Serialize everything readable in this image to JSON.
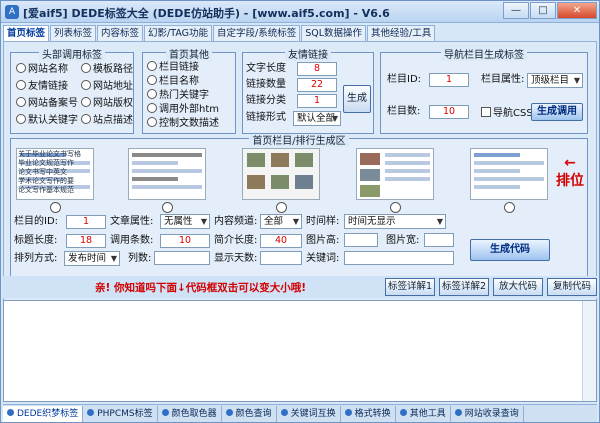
{
  "window": {
    "title": "[爱aif5] DEDE标签大全 (DEDE仿站助手) - [www.aif5.com] - V6.6",
    "icon_letter": "A",
    "minimize": "—",
    "maximize": "□",
    "close": "✕"
  },
  "tabs": [
    {
      "label": "首页标签"
    },
    {
      "label": "列表标签"
    },
    {
      "label": "内容标签"
    },
    {
      "label": "幻影/TAG功能"
    },
    {
      "label": "自定字段/系统标签"
    },
    {
      "label": "SQL数据操作"
    },
    {
      "label": "其他经验/工具"
    }
  ],
  "header_common": {
    "title": "头部调用标签",
    "items": [
      "网站名称",
      "模板路径",
      "友情链接",
      "网站地址",
      "网站备案号",
      "网站版权",
      "默认关键字",
      "站点描述"
    ]
  },
  "homepage_other": {
    "title": "首页其他",
    "items": [
      "栏目链接",
      "栏目名称",
      "热门关键字",
      "调用外部htm",
      "控制文数描述"
    ]
  },
  "friend_links": {
    "title": "友情链接",
    "text_length_label": "文字长度",
    "text_length": "8",
    "link_count_label": "链接数量",
    "link_count": "22",
    "link_category_label": "链接分类",
    "link_category": "1",
    "link_style_label": "链接形式",
    "link_style": "默认全部",
    "generate_button": "生成"
  },
  "nav_columns": {
    "title": "导航栏目生成标签",
    "column_id_label": "栏目ID:",
    "column_id": "1",
    "column_attr_label": "栏目属性:",
    "column_attr": "顶级栏目",
    "column_count_label": "栏目数:",
    "column_count": "10",
    "nav_css_label": "导航CSS",
    "call_button": "生成调用"
  },
  "column_list": {
    "title": "首页栏目/排行生成区",
    "sort_label": "排位",
    "arrow": "←",
    "column_id_label": "栏目的ID:",
    "column_id": "1",
    "article_attr_label": "文章属性:",
    "article_attr": "无属性",
    "content_channel_label": "内容频道:",
    "content_channel": "全部",
    "time_style_label": "时间样:",
    "time_style": "时间无显示",
    "title_length_label": "标题长度:",
    "title_length": "18",
    "call_count_label": "调用条数:",
    "call_count": "10",
    "intro_length_label": "简介长度:",
    "intro_length": "40",
    "img_height_label": "图片高:",
    "img_height": "",
    "img_width_label": "图片宽:",
    "img_width": "",
    "sort_method_label": "排列方式:",
    "sort_method": "发布时间",
    "columns_label": "列数:",
    "columns": "",
    "show_days_label": "显示天数:",
    "show_days": "",
    "keywords_label": "关键词:",
    "keywords": "",
    "generate_code_button": "生成代码",
    "thumb_text": [
      "关于毕业论文书写格",
      "毕业论文规范写作",
      "论文书写中英文",
      "学术论文写作的要",
      "论文写作基本规范"
    ]
  },
  "status": {
    "message": "亲! 你知道吗下面↓代码框双击可以变大小哦!",
    "buttons": [
      "标签详解1",
      "标签详解2",
      "放大代码",
      "复制代码"
    ]
  },
  "bottom_tabs": [
    {
      "label": "DEDE织梦标签"
    },
    {
      "label": "PHPCMS标签"
    },
    {
      "label": "颜色取色器"
    },
    {
      "label": "颜色查询"
    },
    {
      "label": "关键词互换"
    },
    {
      "label": "格式转换"
    },
    {
      "label": "其他工具"
    },
    {
      "label": "网站收录查询"
    }
  ]
}
